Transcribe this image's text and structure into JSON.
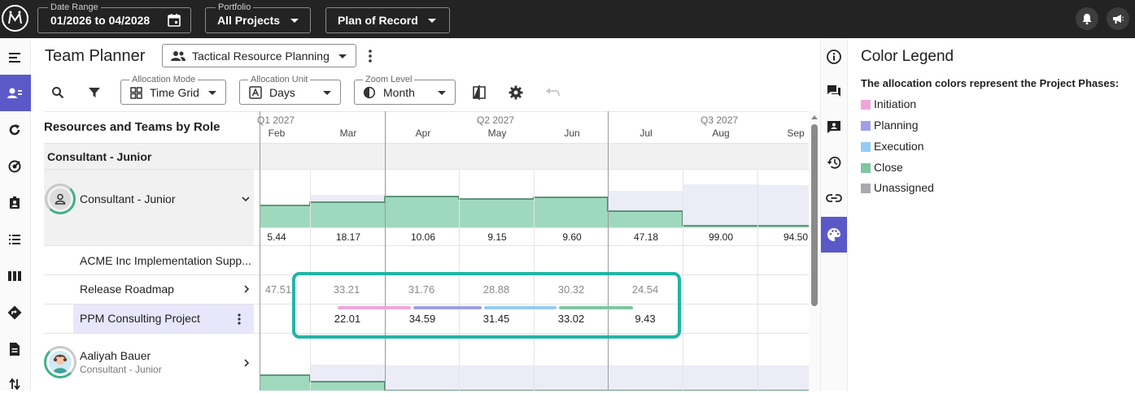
{
  "topbar": {
    "date_range_label": "Date Range",
    "date_range_value": "01/2026 to 04/2028",
    "portfolio_label": "Portfolio",
    "portfolio_value": "All Projects",
    "plan_value": "Plan of Record",
    "logo_icon": "app-logo-icon",
    "notifications_icon": "bell-icon",
    "announcements_icon": "megaphone-icon"
  },
  "leftnav": {
    "items": [
      "menu-icon",
      "team-planner-icon",
      "refresh-icon",
      "target-icon",
      "badge-icon",
      "list-icon",
      "columns-icon",
      "route-icon",
      "document-icon",
      "swap-icon"
    ],
    "active_color": "#5b59c8"
  },
  "header": {
    "title": "Team Planner",
    "view_selector": "Tactical Resource Planning"
  },
  "toolbar": {
    "allocation_mode_label": "Allocation Mode",
    "allocation_mode_value": "Time Grid",
    "allocation_unit_label": "Allocation Unit",
    "allocation_unit_value": "Days",
    "zoom_level_label": "Zoom Level",
    "zoom_level_value": "Month"
  },
  "grid": {
    "left_header": "Resources and Teams by Role",
    "quarters": [
      "Q1 2027",
      "Q2 2027",
      "Q3 2027"
    ],
    "months": [
      "Feb",
      "Mar",
      "Apr",
      "May",
      "Jun",
      "Jul",
      "Aug",
      "Sep"
    ],
    "group_label": "Consultant - Junior",
    "role_row": {
      "name": "Consultant - Junior",
      "totals": [
        "5.44",
        "18.17",
        "10.06",
        "9.15",
        "9.60",
        "47.18",
        "99.00",
        "94.50"
      ]
    },
    "projects": [
      {
        "name": "ACME Inc Implementation Supp..."
      },
      {
        "name": "Release Roadmap",
        "values": [
          "47.51",
          "33.21",
          "31.76",
          "28.88",
          "30.32",
          "24.54"
        ]
      },
      {
        "name": "PPM Consulting Project",
        "values": [
          "22.01",
          "34.59",
          "31.45",
          "33.02",
          "9.43"
        ]
      }
    ],
    "person": {
      "name": "Aaliyah Bauer",
      "role": "Consultant - Junior"
    }
  },
  "colors": {
    "initiation": "#f0a6da",
    "planning": "#9f9fe6",
    "execution": "#94cbf2",
    "close": "#7ec6a0",
    "unassigned": "#a9a9b3",
    "allocation_fill": "#9fd9bd",
    "capacity_fill": "#ececf7",
    "highlight_frame": "#1fb6a6"
  },
  "legend": {
    "title": "Color Legend",
    "description": "The allocation colors represent the Project Phases:",
    "items": [
      "Initiation",
      "Planning",
      "Execution",
      "Close",
      "Unassigned"
    ]
  }
}
